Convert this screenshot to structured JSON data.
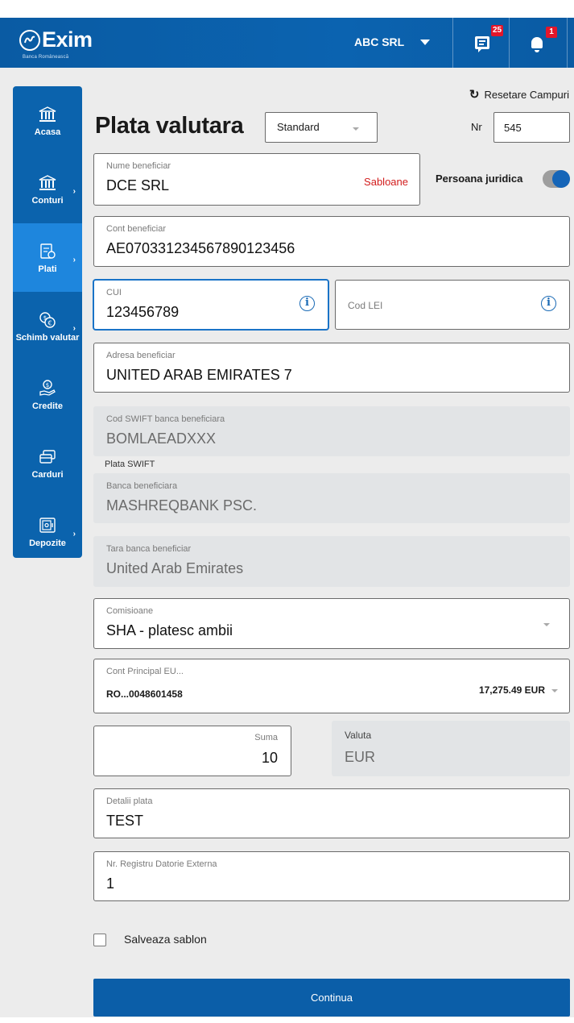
{
  "header": {
    "brand": "Exim",
    "brand_sub": "Banca Românească",
    "company": "ABC SRL",
    "messages_count": "25",
    "notifications_count": "1"
  },
  "sidebar": {
    "items": [
      {
        "label": "Acasa",
        "icon": "bank-icon"
      },
      {
        "label": "Conturi",
        "icon": "bank-icon"
      },
      {
        "label": "Plati",
        "icon": "payment-icon"
      },
      {
        "label": "Schimb valutar",
        "icon": "currency-exchange-icon"
      },
      {
        "label": "Credite",
        "icon": "credit-icon"
      },
      {
        "label": "Carduri",
        "icon": "cards-icon"
      },
      {
        "label": "Depozite",
        "icon": "deposit-icon"
      }
    ]
  },
  "form": {
    "reset_label": "Resetare Campuri",
    "title": "Plata valutara",
    "type_selected": "Standard",
    "nr_label": "Nr",
    "nr_value": "545",
    "beneficiary_name_label": "Nume beneficiar",
    "beneficiary_name_value": "DCE SRL",
    "templates_link": "Sabloane",
    "legal_entity_label": "Persoana juridica",
    "account_label": "Cont beneficiar",
    "account_value": "AE070331234567890123456",
    "cui_label": "CUI",
    "cui_value": "123456789",
    "lei_label": "Cod LEI",
    "address_label": "Adresa beneficiar",
    "address_value": "UNITED ARAB EMIRATES 7",
    "swift_label": "Cod SWIFT banca beneficiara",
    "swift_value": "BOMLAEADXXX",
    "swift_section": "Plata SWIFT",
    "bank_label": "Banca beneficiara",
    "bank_value": "MASHREQBANK PSC.",
    "bank_country_label": "Tara banca beneficiar",
    "bank_country_value": "United Arab Emirates",
    "fees_label": "Comisioane",
    "fees_value": "SHA - platesc ambii",
    "source_account_label": "Cont Principal EU...",
    "source_account_value": "RO...0048601458",
    "source_account_balance": "17,275.49 EUR",
    "amount_label": "Suma",
    "amount_value": "10",
    "currency_label": "Valuta",
    "currency_value": "EUR",
    "details_label": "Detalii plata",
    "details_value": "TEST",
    "registry_label": "Nr. Registru Datorie Externa",
    "registry_value": "1",
    "save_template_label": "Salveaza sablon",
    "continue_label": "Continua"
  },
  "colors": {
    "header_blue": "#0b63b0",
    "sidebar_blue": "#0b63ad",
    "sidebar_active": "#1e86dd",
    "badge_red": "#e3162a",
    "link_red": "#d21c1c",
    "button_blue": "#0b5ea8"
  }
}
